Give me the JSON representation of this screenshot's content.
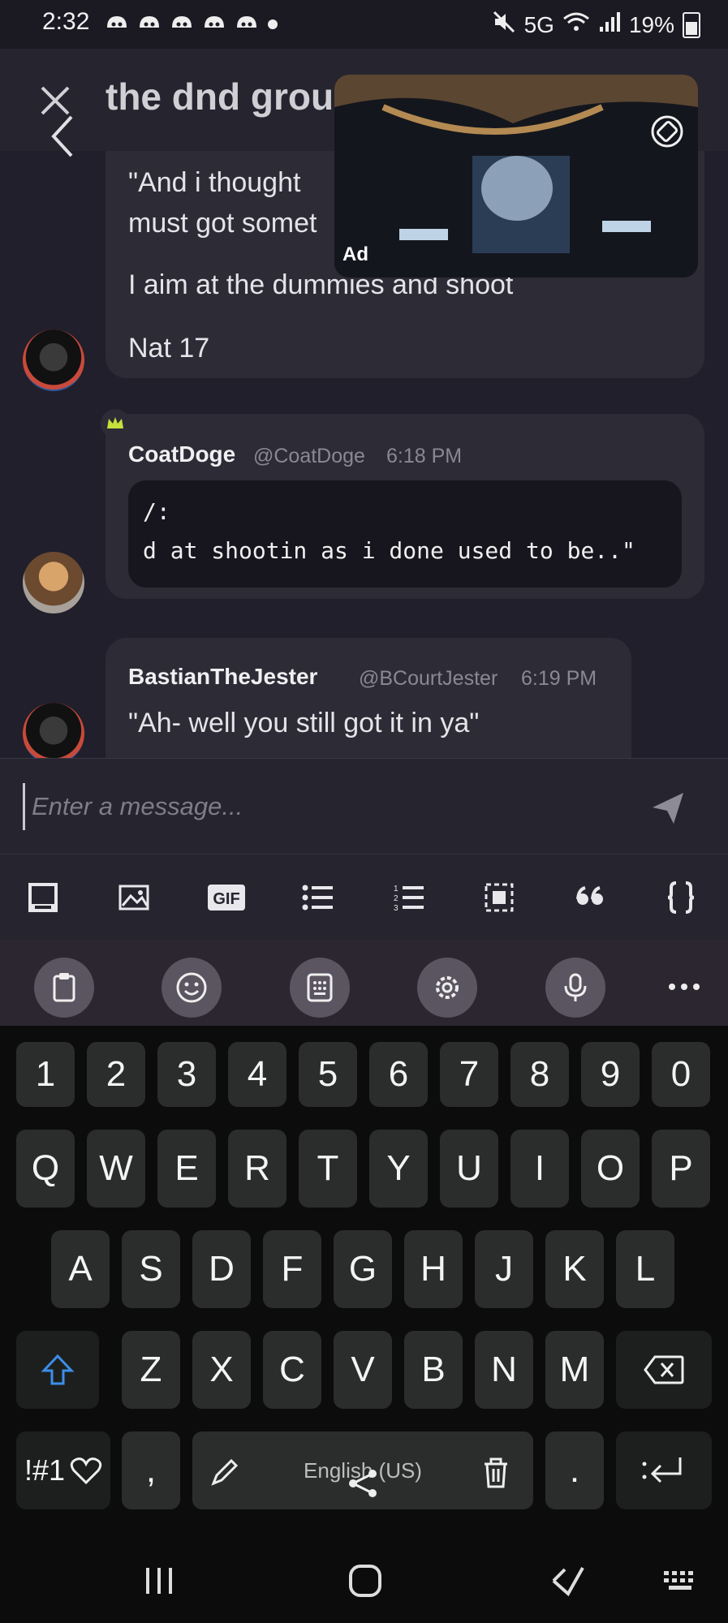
{
  "status_bar": {
    "time": "2:32",
    "battery": "19%",
    "network": "5G"
  },
  "header": {
    "title": "the dnd group"
  },
  "ad": {
    "label": "Ad"
  },
  "messages": [
    {
      "lines": [
        "\"And i thought",
        "must got somet",
        "I aim at the dummies and shoot",
        "Nat 17"
      ]
    },
    {
      "author": "CoatDoge",
      "handle": "@CoatDoge",
      "time": "6:18 PM",
      "code_lines": [
        "/:",
        "d at shootin as i done used to be..\""
      ]
    },
    {
      "author": "BastianTheJester",
      "handle": "@BCourtJester",
      "time": "6:19 PM",
      "text": "\"Ah- well you still got it in ya\""
    }
  ],
  "composer": {
    "placeholder": "Enter a message..."
  },
  "format_toolbar": [
    "spoiler-icon",
    "image-icon",
    "gif-icon",
    "bullet-list-icon",
    "numbered-list-icon",
    "selection-icon",
    "quote-icon",
    "code-braces-icon"
  ],
  "keyboard_toolbar": [
    "clipboard-icon",
    "emoji-icon",
    "keypad-icon",
    "settings-icon",
    "microphone-icon",
    "more-icon"
  ],
  "keyboard": {
    "numbers": [
      "1",
      "2",
      "3",
      "4",
      "5",
      "6",
      "7",
      "8",
      "9",
      "0"
    ],
    "row1": [
      "Q",
      "W",
      "E",
      "R",
      "T",
      "Y",
      "U",
      "I",
      "O",
      "P"
    ],
    "row2": [
      "A",
      "S",
      "D",
      "F",
      "G",
      "H",
      "J",
      "K",
      "L"
    ],
    "row3": [
      "Z",
      "X",
      "C",
      "V",
      "B",
      "N",
      "M"
    ],
    "symbols_label": "!#1",
    "comma": ",",
    "space_label": "English (US)",
    "period": "."
  },
  "colors": {
    "accent_crown": "#c7e03a",
    "chat_bg": "#221f2c",
    "keyboard_bg": "#0c0c0c"
  }
}
